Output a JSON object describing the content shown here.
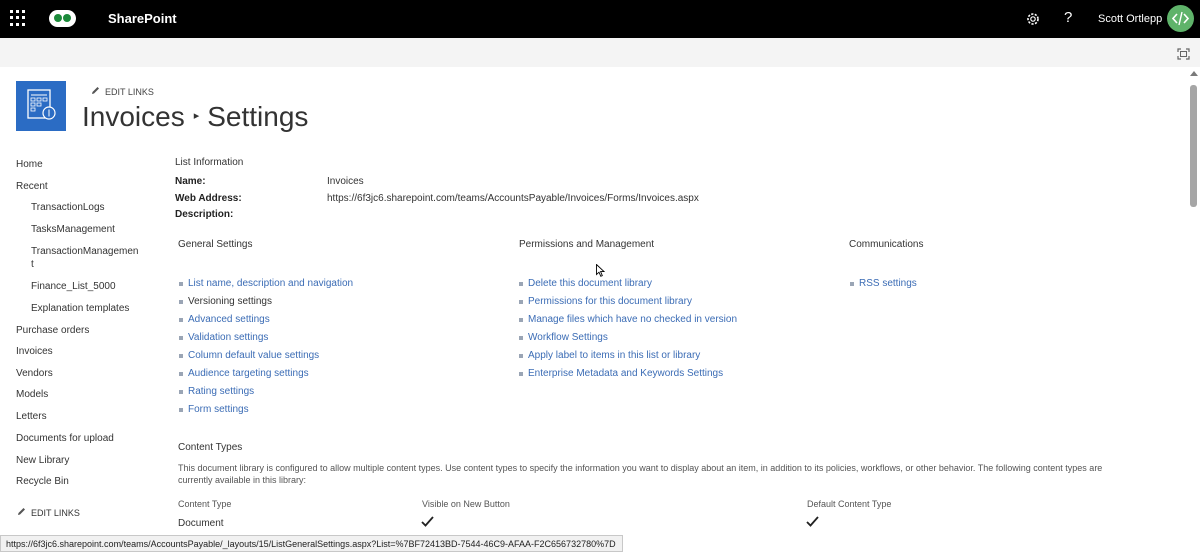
{
  "suite": {
    "app_name": "SharePoint",
    "user_name": "Scott Ortlepp",
    "help_label": "?"
  },
  "header": {
    "edit_links": "EDIT LINKS",
    "title_part1": "Invoices",
    "title_sep": "▸",
    "title_part2": "Settings"
  },
  "nav": {
    "items": [
      {
        "label": "Home",
        "level": 0
      },
      {
        "label": "Recent",
        "level": 0
      },
      {
        "label": "TransactionLogs",
        "level": 1
      },
      {
        "label": "TasksManagement",
        "level": 1
      },
      {
        "label": "TransactionManagemen",
        "level": 1
      },
      {
        "label": "t",
        "level": 1
      },
      {
        "label": "Finance_List_5000",
        "level": 1
      },
      {
        "label": "Explanation templates",
        "level": 1
      },
      {
        "label": "Purchase orders",
        "level": 0
      },
      {
        "label": "Invoices",
        "level": 0
      },
      {
        "label": "Vendors",
        "level": 0
      },
      {
        "label": "Models",
        "level": 0
      },
      {
        "label": "Letters",
        "level": 0
      },
      {
        "label": "Documents for upload",
        "level": 0
      },
      {
        "label": "New Library",
        "level": 0
      },
      {
        "label": "Recycle Bin",
        "level": 0
      }
    ],
    "edit_links": "EDIT LINKS"
  },
  "list_info": {
    "heading": "List Information",
    "name_label": "Name:",
    "name_value": "Invoices",
    "web_label": "Web Address:",
    "web_value": "https://6f3jc6.sharepoint.com/teams/AccountsPayable/Invoices/Forms/Invoices.aspx",
    "desc_label": "Description:"
  },
  "general": {
    "heading": "General Settings",
    "links": [
      "List name, description and navigation",
      "Versioning settings",
      "Advanced settings",
      "Validation settings",
      "Column default value settings",
      "Audience targeting settings",
      "Rating settings",
      "Form settings"
    ]
  },
  "permissions": {
    "heading": "Permissions and Management",
    "links": [
      "Delete this document library",
      "Permissions for this document library",
      "Manage files which have no checked in version",
      "Workflow Settings",
      "Apply label to items in this list or library",
      "Enterprise Metadata and Keywords Settings"
    ]
  },
  "communications": {
    "heading": "Communications",
    "links": [
      "RSS settings"
    ]
  },
  "content_types": {
    "heading": "Content Types",
    "description": "This document library is configured to allow multiple content types. Use content types to specify the information you want to display about an item, in addition to its policies, workflows, or other behavior. The following content types are currently available in this library:",
    "col_type": "Content Type",
    "col_visible": "Visible on New Button",
    "col_default": "Default Content Type",
    "row_type": "Document"
  },
  "status_bar": "https://6f3jc6.sharepoint.com/teams/AccountsPayable/_layouts/15/ListGeneralSettings.aspx?List=%7BF72413BD-7544-46C9-AFAA-F2C656732780%7D",
  "colors": {
    "suite_bg": "#000000",
    "link": "#3b6cb5",
    "site_logo": "#2b6cc4",
    "avatar": "#5fb36a"
  },
  "icons": [
    "waffle-icon",
    "app-logo-icon",
    "gear-icon",
    "help-icon",
    "code-avatar-icon",
    "focus-mode-icon",
    "pencil-icon",
    "checkmark-icon",
    "mouse-cursor-icon"
  ]
}
